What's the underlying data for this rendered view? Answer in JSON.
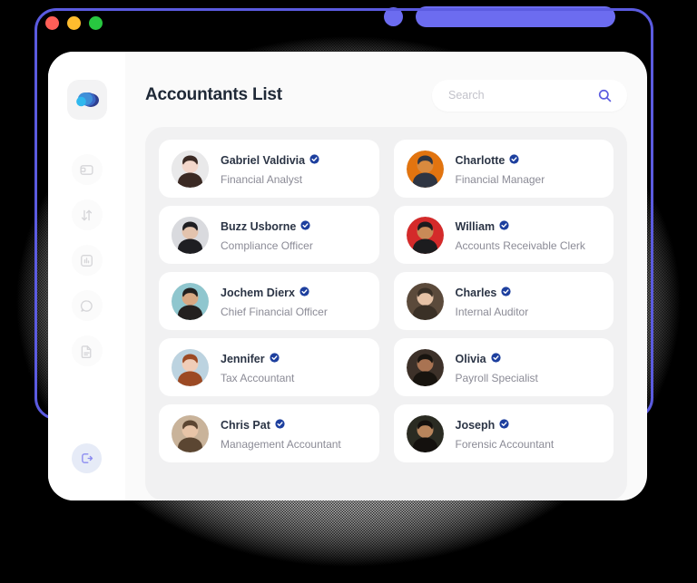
{
  "window": {
    "traffic_lights": [
      "close",
      "minimize",
      "maximize"
    ]
  },
  "sidebar": {
    "logo_name": "cloud-logo",
    "nav_items": [
      {
        "icon": "wallet-icon",
        "label": "Wallet"
      },
      {
        "icon": "transfer-icon",
        "label": "Transfers"
      },
      {
        "icon": "chart-icon",
        "label": "Reports"
      },
      {
        "icon": "chat-icon",
        "label": "Messages"
      },
      {
        "icon": "document-icon",
        "label": "Documents"
      }
    ],
    "logout": {
      "icon": "logout-icon",
      "label": "Log out"
    }
  },
  "header": {
    "title": "Accountants List"
  },
  "search": {
    "placeholder": "Search",
    "value": "",
    "icon": "search-icon"
  },
  "accent_colors": {
    "purple": "#6c6cf0",
    "outline_purple": "#5b5be0",
    "badge_blue": "#1d3f9e",
    "title": "#1f2937",
    "role_text": "#8b8b96",
    "panel_bg": "#f1f1f2",
    "card_bg": "#ffffff"
  },
  "accountants": [
    {
      "name": "Gabriel Valdivia",
      "role": "Financial Analyst",
      "verified": true,
      "avatar": "woman-dark-updo",
      "c1": "#f3d7cb",
      "c2": "#3b2a24",
      "c3": "#e9e9ea"
    },
    {
      "name": "Charlotte",
      "role": "Financial Manager",
      "verified": true,
      "avatar": "woman-orange-bg",
      "c1": "#d98a3e",
      "c2": "#2e3542",
      "c3": "#e2740f"
    },
    {
      "name": "Buzz Usborne",
      "role": "Compliance Officer",
      "verified": true,
      "avatar": "man-dark-shirt",
      "c1": "#e3c3ad",
      "c2": "#1e1e22",
      "c3": "#d9dade"
    },
    {
      "name": "William",
      "role": "Accounts Receivable Clerk",
      "verified": true,
      "avatar": "man-red-bg",
      "c1": "#c98a57",
      "c2": "#1c1c1e",
      "c3": "#d42a2a"
    },
    {
      "name": "Jochem Dierx",
      "role": "Chief Financial Officer",
      "verified": true,
      "avatar": "man-teal-bg",
      "c1": "#d8a883",
      "c2": "#23201f",
      "c3": "#8fc6ce"
    },
    {
      "name": "Charles",
      "role": "Internal Auditor",
      "verified": true,
      "avatar": "man-suit-tie",
      "c1": "#e6c2a6",
      "c2": "#3a3026",
      "c3": "#5b4a3b"
    },
    {
      "name": "Jennifer",
      "role": "Tax Accountant",
      "verified": true,
      "avatar": "woman-red-hair",
      "c1": "#f0cdb8",
      "c2": "#9c4a24",
      "c3": "#bcd3e0"
    },
    {
      "name": "Olivia",
      "role": "Payroll Specialist",
      "verified": true,
      "avatar": "woman-dark-hair",
      "c1": "#a97352",
      "c2": "#18140f",
      "c3": "#3d3129"
    },
    {
      "name": "Chris Pat",
      "role": "Management Accountant",
      "verified": true,
      "avatar": "man-light-shirt",
      "c1": "#e8c5a8",
      "c2": "#5b4632",
      "c3": "#c9b39a"
    },
    {
      "name": "Joseph",
      "role": "Forensic Accountant",
      "verified": true,
      "avatar": "man-dark-bg",
      "c1": "#b8855c",
      "c2": "#14110e",
      "c3": "#2a2b22"
    }
  ]
}
